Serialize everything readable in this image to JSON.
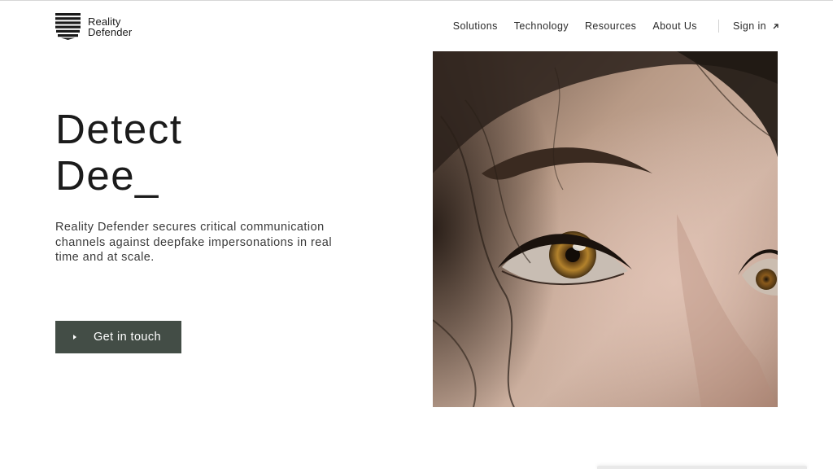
{
  "brand": {
    "name_line1": "Reality",
    "name_line2": "Defender",
    "logo_icon": "stacked-stripes-shield-icon"
  },
  "nav": {
    "items": [
      {
        "label": "Solutions"
      },
      {
        "label": "Technology"
      },
      {
        "label": "Resources"
      },
      {
        "label": "About Us"
      }
    ],
    "signin_label": "Sign in",
    "signin_icon": "arrow-up-right-icon"
  },
  "hero": {
    "headline_line1": "Detect",
    "headline_line2": "Dee_",
    "subtext": "Reality Defender secures critical communication channels against deepfake impersonations in real time and at scale.",
    "cta_label": "Get in touch",
    "cta_icon": "play-triangle-icon",
    "image_subject": "close-up-eye-photo"
  },
  "colors": {
    "cta_background": "#434d46",
    "text_primary": "#1b1b1b"
  }
}
